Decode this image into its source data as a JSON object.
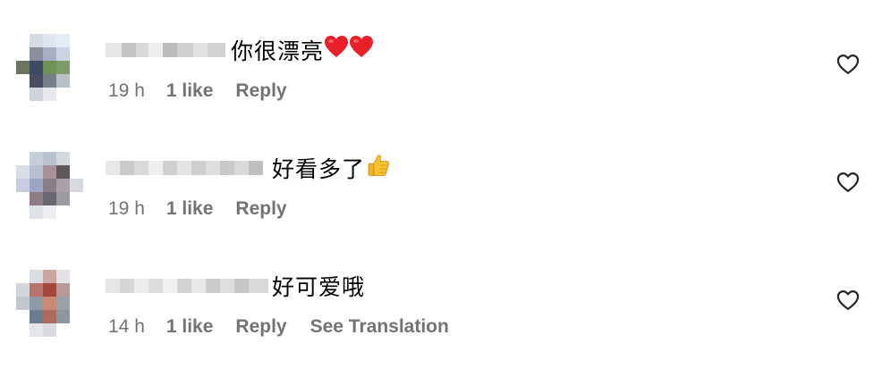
{
  "comments": [
    {
      "text": "你很漂亮",
      "emoji": "❤️❤️",
      "time": "19 h",
      "likes": "1 like",
      "reply": "Reply",
      "like_icon": "heart-outline-icon"
    },
    {
      "text": "好看多了",
      "emoji": "👍",
      "time": "19 h",
      "likes": "1 like",
      "reply": "Reply",
      "like_icon": "heart-outline-icon"
    },
    {
      "text": "好可爱哦",
      "time": "14 h",
      "likes": "1 like",
      "reply": "Reply",
      "translate": "See Translation",
      "like_icon": "heart-outline-icon"
    }
  ],
  "colors": {
    "meta_text": "#737373",
    "icon": "#262626"
  }
}
